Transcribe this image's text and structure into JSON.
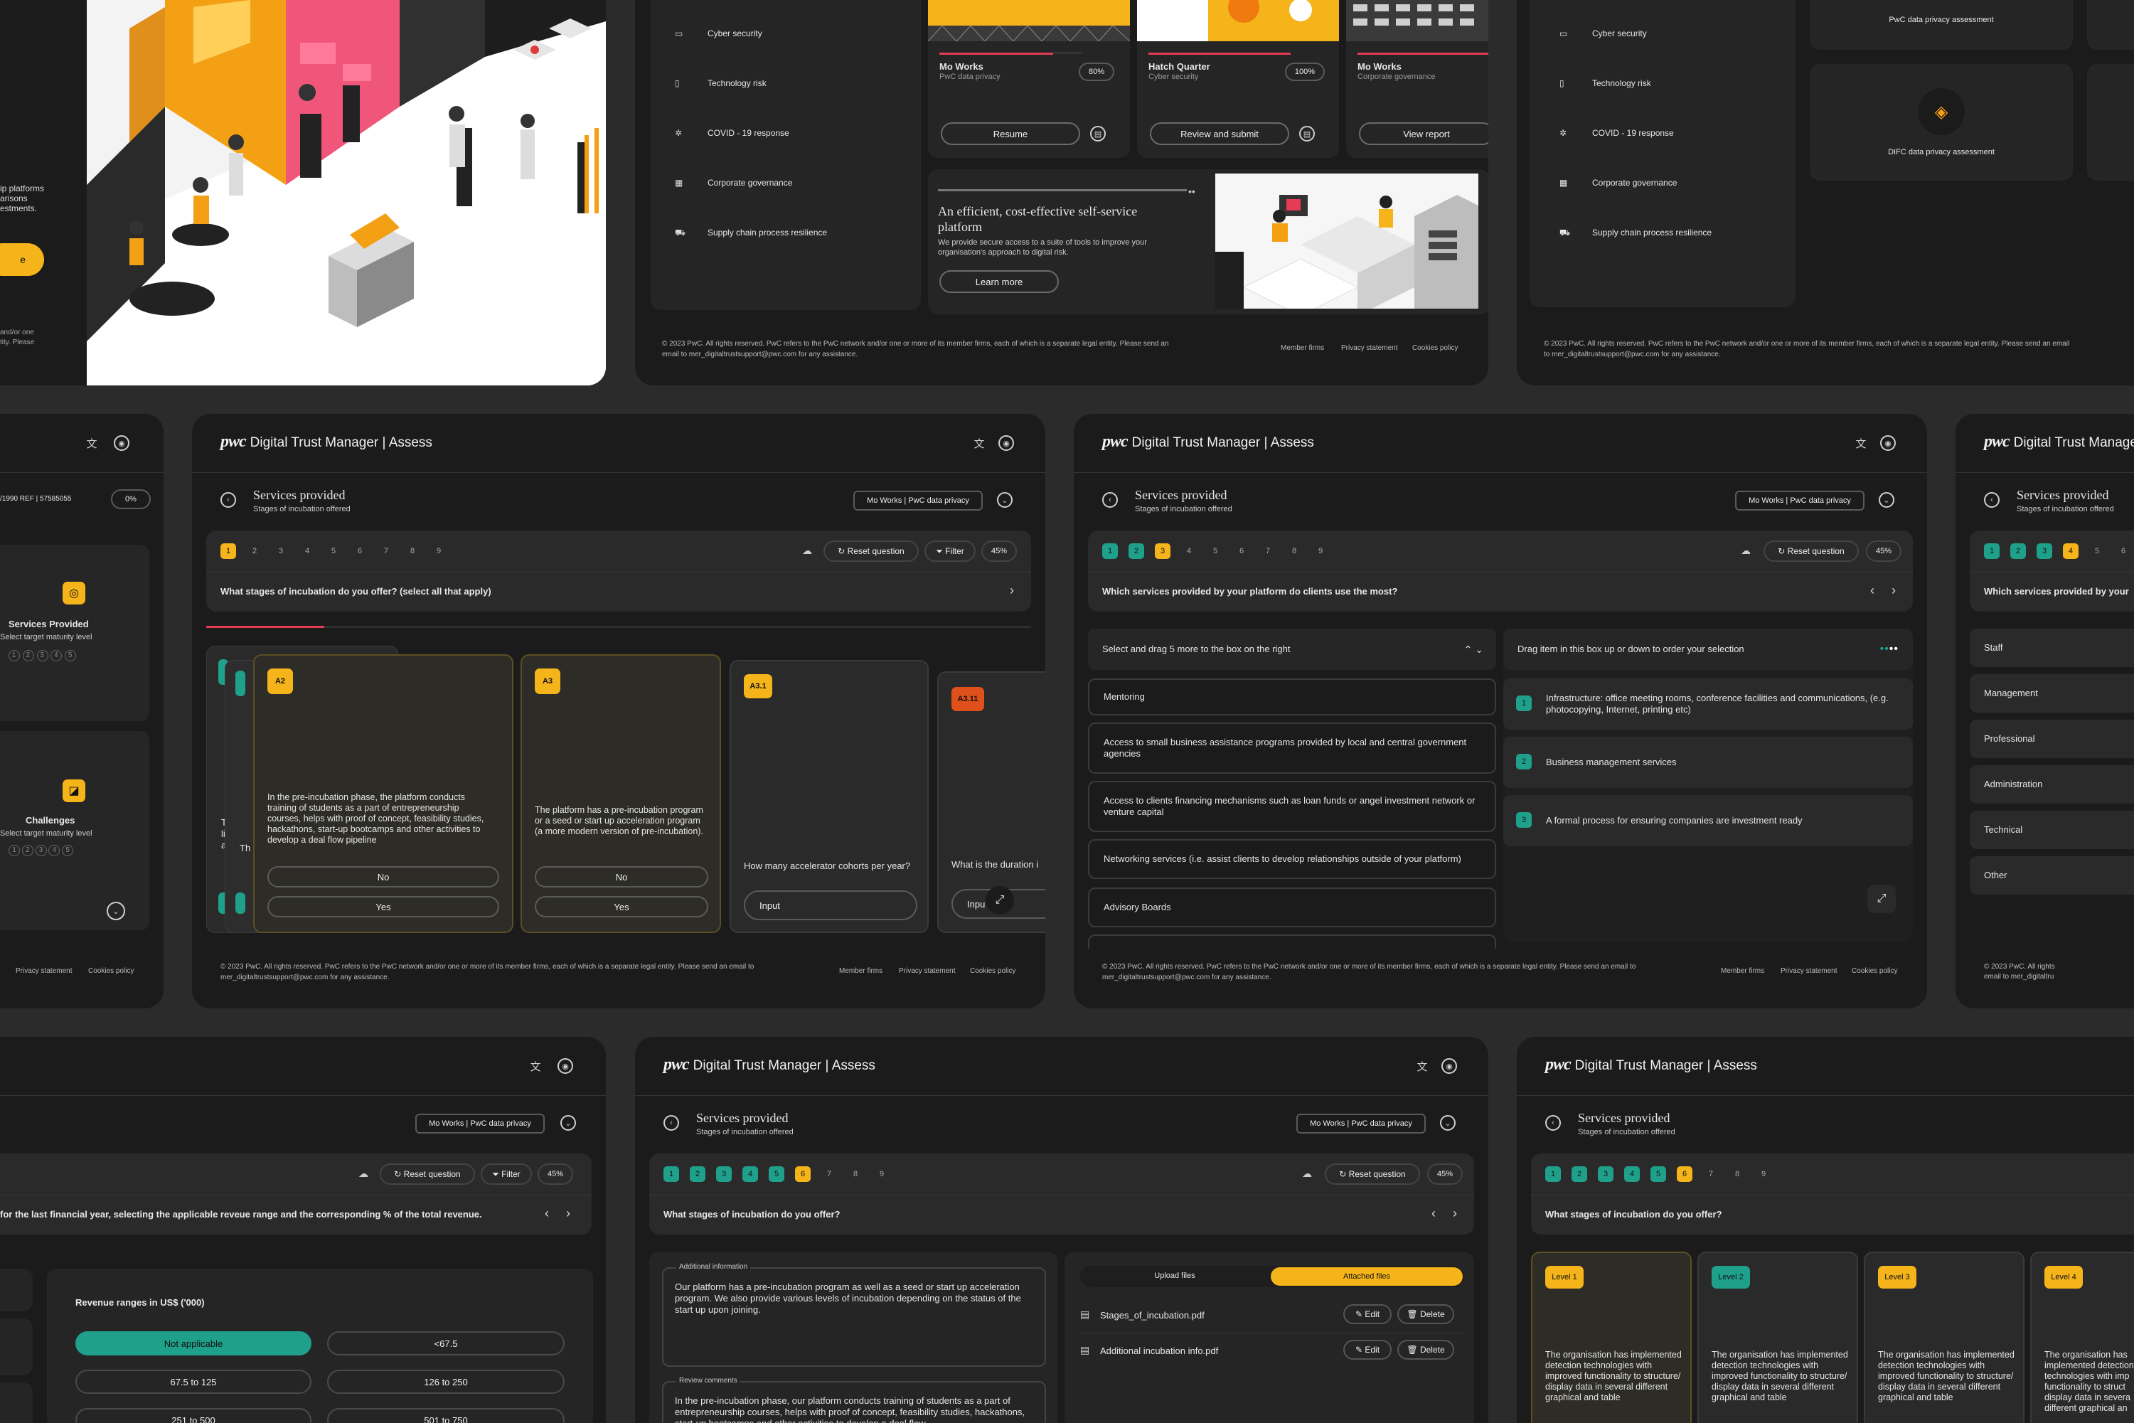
{
  "brand": {
    "logo": "pwc",
    "product": "Digital Trust Manager | Assess"
  },
  "nav_items": [
    "Cyber security",
    "Technology risk",
    "COVID - 19 response",
    "Corporate governance",
    "Supply chain process resilience"
  ],
  "footer": {
    "copyright": "© 2023 PwC. All rights reserved. PwC refers to the PwC network and/or one or more of its member firms, each of which is a separate legal entity. Please send an email to mer_digitaltrustsupport@pwc.com for any assistance.",
    "links": [
      "Member firms",
      "Privacy statement",
      "Cookies policy"
    ]
  },
  "landing_left": {
    "text_lines": [
      "ip platforms",
      "arisons",
      "estments."
    ],
    "footer_lines": [
      "and/or one",
      "tity. Please"
    ]
  },
  "dashboard": {
    "projects": [
      {
        "name": "Mo Works",
        "sub": "PwC data privacy",
        "pct": "80%",
        "action": "Resume"
      },
      {
        "name": "Hatch Quarter",
        "sub": "Cyber security",
        "pct": "100%",
        "action": "Review and submit"
      },
      {
        "name": "Mo Works",
        "sub": "Corporate governance",
        "pct": "",
        "action": "View report"
      }
    ],
    "promo": {
      "title": "An efficient, cost-effective self-service platform",
      "body": "We provide secure access to a suite of tools to improve your organisation's approach to digital risk.",
      "cta": "Learn more"
    }
  },
  "assessments_top": {
    "items": [
      "PwC data privacy assessment",
      "DIFC data privacy assessment"
    ]
  },
  "left_mid": {
    "ref": "/1990   REF | 57585055",
    "pct": "0%",
    "cards": [
      {
        "title": "Services Provided",
        "sub": "Select target maturity level"
      },
      {
        "title": "Challenges",
        "sub": "Select target maturity level"
      }
    ],
    "levels": [
      "1",
      "2",
      "3",
      "4",
      "5"
    ],
    "footer_links": [
      "Privacy statement",
      "Cookies policy"
    ]
  },
  "assess": {
    "section_title": "Services provided",
    "section_sub": "Stages of incubation offered",
    "context": "Mo Works | PwC data privacy",
    "reset": "Reset question",
    "filter": "Filter",
    "pct": "45%",
    "steps": [
      "1",
      "2",
      "3",
      "4",
      "5",
      "6",
      "7",
      "8",
      "9"
    ]
  },
  "screen_a": {
    "question": "What stages of incubation do you offer? (select all that apply)",
    "cards": [
      {
        "code": "A2",
        "text": "In the pre-incubation phase, the platform conducts training of students as a part of entrepreneurship courses, helps with proof of concept, feasibility studies, hackathons, start-up bootcamps and other activities to develop a deal flow pipeline",
        "no": "No",
        "yes": "Yes"
      },
      {
        "code": "A3",
        "text": "The platform has a pre-incubation program or a seed or start up acceleration program (a more modern version of pre-incubation).",
        "no": "No",
        "yes": "Yes"
      },
      {
        "code": "A3.1",
        "text": "How many accelerator cohorts per year?",
        "input": "Input"
      },
      {
        "code": "A3.11",
        "text": "What is the duration i",
        "input": "Inpu"
      }
    ],
    "behind": [
      "Th",
      "lin",
      "an",
      "Th"
    ]
  },
  "screen_b": {
    "question": "Which services provided by your platform do clients use the most?",
    "left_header": "Select and drag 5 more to the box on the right",
    "right_header": "Drag item in this box up or down to order your selection",
    "options": [
      "Mentoring",
      "Access to small business assistance programs provided by local and central government agencies",
      "Access to clients financing mechanisms such as loan funds or angel investment network or venture capital",
      "Networking services (i.e. assist clients to develop relationships outside of your platform)",
      "Advisory Boards"
    ],
    "ranked": [
      {
        "n": "1",
        "text": "Infrastructure: office meeting rooms, conference facilities and communications, (e.g. photocopying, Internet, printing etc)"
      },
      {
        "n": "2",
        "text": "Business management services"
      },
      {
        "n": "3",
        "text": "A formal process for ensuring companies are investment ready"
      }
    ]
  },
  "screen_c": {
    "question": "Which services provided by your",
    "options": [
      "Staff",
      "Management",
      "Professional",
      "Administration",
      "Technical",
      "Other"
    ],
    "footer_lines": [
      "© 2023 PwC. All rights",
      "email to mer_digitaltru"
    ]
  },
  "screen_d": {
    "question": "for the last financial year, selecting the applicable reveue range and the corresponding % of the total revenue.",
    "box_title": "Revenue ranges in US$ ('000)",
    "ranges": [
      "Not applicable",
      "<67.5",
      "67.5 to 125",
      "126 to 250",
      "251 to 500",
      "501 to 750"
    ]
  },
  "screen_e": {
    "question": "What stages of incubation do you offer?",
    "additional_label": "Additional information",
    "additional_text": "Our platform has a pre-incubation program as well as a seed or start up acceleration program. We also provide various levels of incubation depending on the status of the start up upon joining.",
    "review_label": "Review comments",
    "review_text": "In the pre-incubation phase, our platform conducts training of students as a part of entrepreneurship courses, helps with proof of concept, feasibility studies, hackathons, start-up bootcamps and other activities to develop a deal flow",
    "tabs": [
      "Upload files",
      "Attached files"
    ],
    "files": [
      "Stages_of_incubation.pdf",
      "Additional incubation info.pdf"
    ],
    "edit": "Edit",
    "delete": "Delete"
  },
  "screen_f": {
    "question": "What stages of incubation do you offer?",
    "levels": [
      {
        "label": "Level 1",
        "color": "#f4b41a"
      },
      {
        "label": "Level 2",
        "color": "#1fa08a"
      },
      {
        "label": "Level 3",
        "color": "#f4b41a"
      },
      {
        "label": "Level 4",
        "color": "#f4b41a"
      }
    ],
    "level_text": "The organisation has implemented detection technologies with improved functionality to structure/ display data in several different graphical and table",
    "level_text_cut": "The organisation has implemented detection technologies with imp functionality to struct display data in severa different graphical an"
  }
}
